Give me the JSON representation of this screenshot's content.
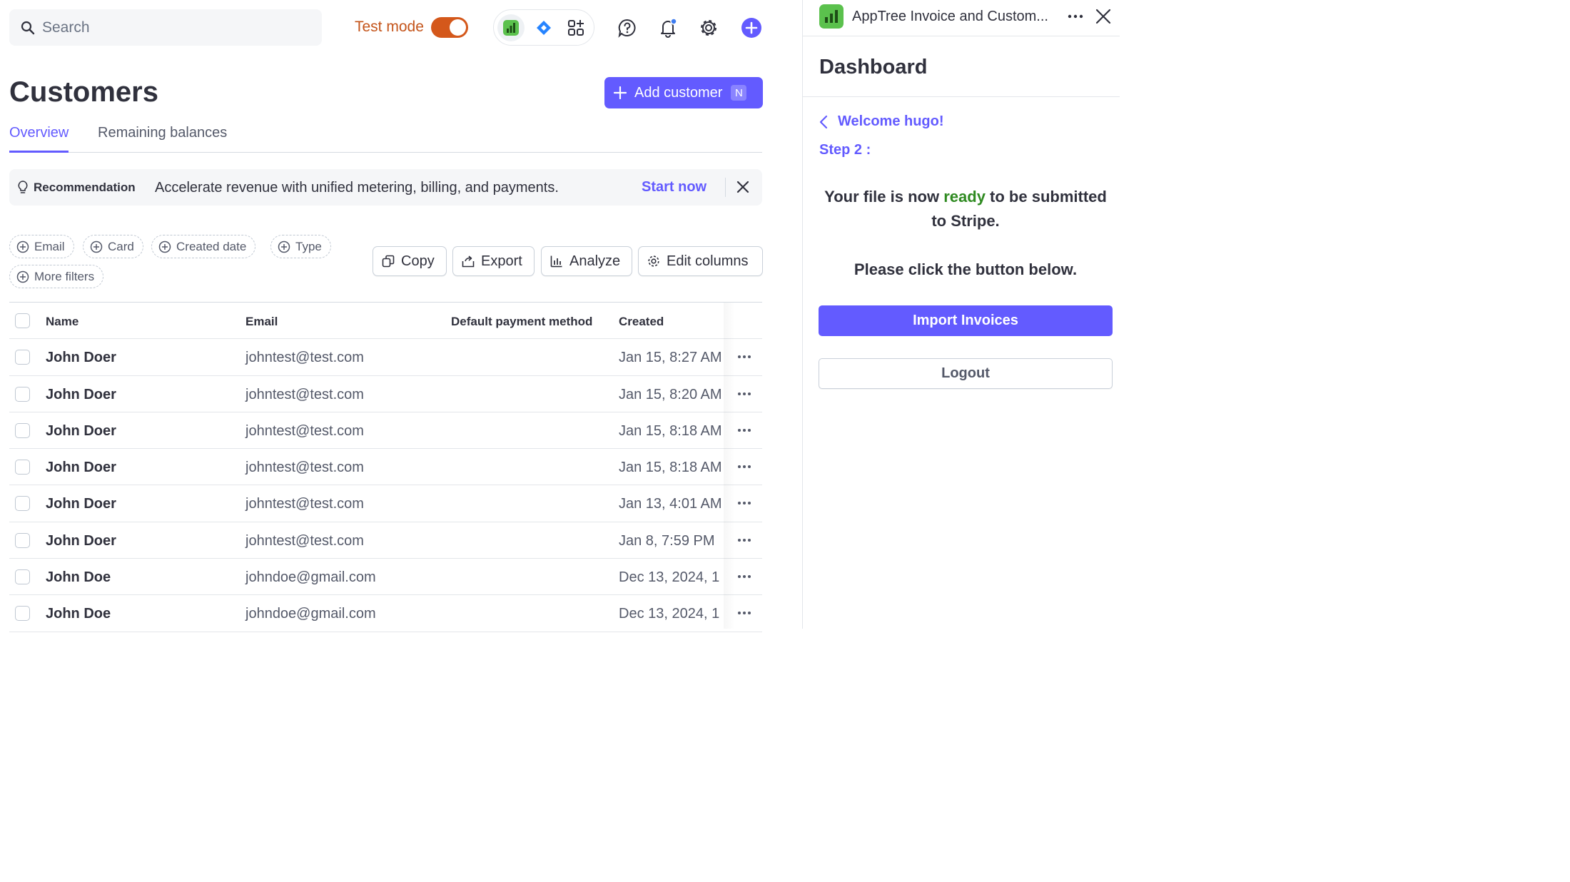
{
  "search": {
    "placeholder": "Search"
  },
  "topbar": {
    "test_mode_label": "Test mode",
    "test_mode_on": true
  },
  "page": {
    "title": "Customers",
    "add_button_label": "Add customer",
    "add_button_shortcut": "N"
  },
  "tabs": [
    {
      "label": "Overview",
      "active": true
    },
    {
      "label": "Remaining balances",
      "active": false
    }
  ],
  "recommendation": {
    "title": "Recommendation",
    "text": "Accelerate revenue with unified metering, billing, and payments.",
    "link": "Start now"
  },
  "filters": [
    "Email",
    "Card",
    "Created date",
    "Type",
    "More filters"
  ],
  "actions": [
    "Copy",
    "Export",
    "Analyze",
    "Edit columns"
  ],
  "table": {
    "columns": [
      "Name",
      "Email",
      "Default payment method",
      "Created"
    ],
    "rows": [
      {
        "name": "John Doer",
        "email": "johntest@test.com",
        "payment": "",
        "created": "Jan 15, 8:27 AM"
      },
      {
        "name": "John Doer",
        "email": "johntest@test.com",
        "payment": "",
        "created": "Jan 15, 8:20 AM"
      },
      {
        "name": "John Doer",
        "email": "johntest@test.com",
        "payment": "",
        "created": "Jan 15, 8:18 AM"
      },
      {
        "name": "John Doer",
        "email": "johntest@test.com",
        "payment": "",
        "created": "Jan 15, 8:18 AM"
      },
      {
        "name": "John Doer",
        "email": "johntest@test.com",
        "payment": "",
        "created": "Jan 13, 4:01 AM"
      },
      {
        "name": "John Doer",
        "email": "johntest@test.com",
        "payment": "",
        "created": "Jan 8, 7:59 PM"
      },
      {
        "name": "John Doe",
        "email": "johndoe@gmail.com",
        "payment": "",
        "created": "Dec 13, 2024, 1"
      },
      {
        "name": "John Doe",
        "email": "johndoe@gmail.com",
        "payment": "",
        "created": "Dec 13, 2024, 1"
      }
    ]
  },
  "panel": {
    "app_name": "AppTree Invoice and Custom...",
    "title": "Dashboard",
    "back_label": "Welcome hugo!",
    "step": "Step 2 :",
    "message_pre": "Your file is now ",
    "message_highlight": "ready",
    "message_post": " to be submitted to Stripe.",
    "instruction": "Please click the button below.",
    "import_label": "Import Invoices",
    "logout_label": "Logout"
  },
  "colors": {
    "accent": "#635bff",
    "test_mode": "#d4581b",
    "ready": "#2f8a21",
    "app_logo": "#5bc14d"
  },
  "icons": [
    "search-icon",
    "apptree-app-icon",
    "jira-app-icon",
    "apps-grid-icon",
    "help-icon",
    "notification-bell-icon",
    "settings-gear-icon",
    "create-plus-icon",
    "lightbulb-icon",
    "close-icon",
    "plus-circle-icon",
    "copy-icon",
    "export-icon",
    "analyze-chart-icon",
    "edit-columns-gear-icon",
    "more-dots-icon",
    "chevron-left-icon"
  ]
}
